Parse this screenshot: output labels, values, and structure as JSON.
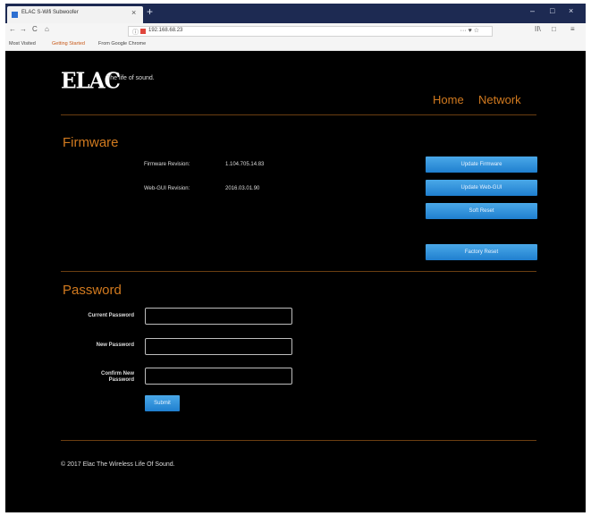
{
  "browser": {
    "tab_title": "ELAC S-Wifi Subwoofer",
    "tab_close": "×",
    "new_tab": "+",
    "url": "192.168.68.23",
    "url_actions": "··· ♥ ☆",
    "bookmarks": [
      "Most Visited",
      "Getting Started",
      "From Google Chrome"
    ],
    "window_controls": [
      "–",
      "□",
      "×"
    ],
    "nav_icons": {
      "back": "←",
      "forward": "→",
      "reload": "C",
      "home": "⌂",
      "library": "II\\",
      "sidebar": "□",
      "menu": "≡"
    }
  },
  "header": {
    "logo": "ELAC",
    "tagline": "The life of sound.",
    "nav": [
      "Home",
      "Network"
    ]
  },
  "firmware": {
    "title": "Firmware",
    "rows": [
      {
        "label": "Firmware Revision:",
        "value": "1.104.705.14.83"
      },
      {
        "label": "Web-GUI Revision:",
        "value": "2016.03.01.90"
      }
    ],
    "buttons": [
      "Update Firmware",
      "Update Web-GUI",
      "Soft Reset",
      "Factory Reset"
    ]
  },
  "password": {
    "title": "Password",
    "fields": [
      {
        "label": "Current Password",
        "value": ""
      },
      {
        "label": "New Password",
        "value": ""
      },
      {
        "label": "Confirm New\nPassword",
        "value": ""
      }
    ],
    "submit": "Submit"
  },
  "footer": {
    "copyright": "© 2017 Elac The Wireless Life Of Sound."
  },
  "colors": {
    "accent": "#d27a1f",
    "button": "#2a8ad8",
    "background": "#000000",
    "tabbar": "#1d2a52"
  }
}
